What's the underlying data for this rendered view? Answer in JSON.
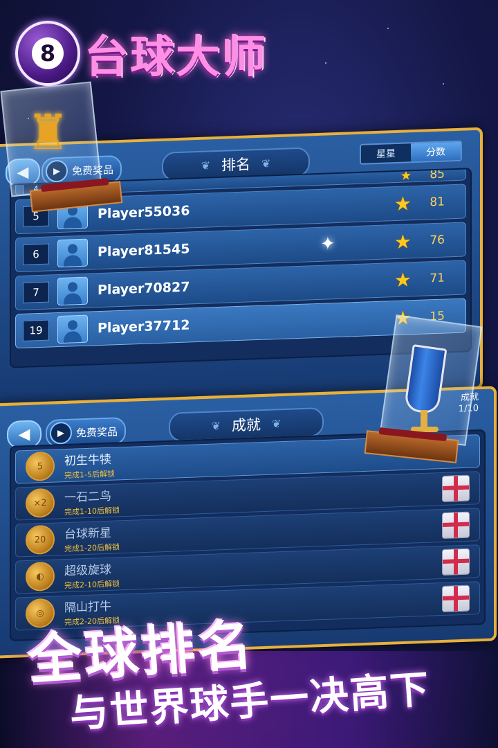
{
  "app_title": "台球大师",
  "logo_ball_number": "8",
  "leaderboard": {
    "title": "排名",
    "free_reward_label": "免费奖品",
    "tabs": [
      {
        "label": "星星",
        "active": false
      },
      {
        "label": "分数",
        "active": true
      }
    ],
    "partial_top": {
      "rank": "4",
      "score": "85"
    },
    "rows": [
      {
        "rank": "5",
        "name": "Player55036",
        "score": "81"
      },
      {
        "rank": "6",
        "name": "Player81545",
        "score": "76"
      },
      {
        "rank": "7",
        "name": "Player70827",
        "score": "71"
      },
      {
        "rank": "19",
        "name": "Player37712",
        "score": "15",
        "self": true
      }
    ]
  },
  "achievements": {
    "title": "成就",
    "free_reward_label": "免费奖品",
    "count_label": "成就",
    "count_value": "1/10",
    "items": [
      {
        "coin": "5",
        "title": "初生牛犊",
        "sub": "完成1-5后解锁",
        "active": true
      },
      {
        "coin": "×2",
        "title": "一石二鸟",
        "sub": "完成1-10后解锁",
        "active": false
      },
      {
        "coin": "20",
        "title": "台球新星",
        "sub": "完成1-20后解锁",
        "active": false
      },
      {
        "coin": "◐",
        "title": "超级旋球",
        "sub": "完成2-10后解锁",
        "active": false
      },
      {
        "coin": "◎",
        "title": "隔山打牛",
        "sub": "完成2-20后解锁",
        "active": false
      }
    ]
  },
  "slogan": {
    "line1": "全球排名",
    "line2": "与世界球手一决高下"
  },
  "icons": [
    "back-arrow-icon",
    "play-icon",
    "star-icon",
    "gift-icon",
    "laurel-icon",
    "avatar-icon",
    "trophy-icon"
  ],
  "colors": {
    "panel_border": "#e7b03b",
    "star": "#ffc81e",
    "accent_pink": "#ff8fe4"
  }
}
